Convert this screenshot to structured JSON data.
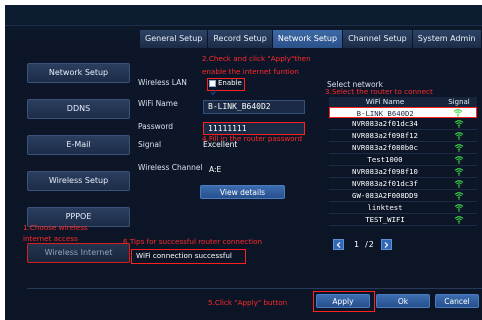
{
  "tabs": [
    "General Setup",
    "Record Setup",
    "Network Setup",
    "Channel Setup",
    "System Admin"
  ],
  "sidebar": [
    "Network Setup",
    "DDNS",
    "E-Mail",
    "Wireless Setup",
    "PPPOE",
    "Wireless Internet"
  ],
  "form": {
    "wireless_lan_label": "Wireless LAN",
    "enable_label": "Enable",
    "enable_checked": true,
    "wifi_name_label": "WiFi Name",
    "wifi_name_value": "B-LINK_B640D2",
    "password_label": "Password",
    "password_value": "11111111",
    "signal_label": "Signal",
    "signal_value": "Excellent",
    "channel_label": "Wireless Channel",
    "channel_value": "A:E",
    "details_button": "View details",
    "status_text": "WiFi connection successful"
  },
  "network_list": {
    "title": "Select network",
    "col_name": "WiFi Name",
    "col_signal": "Signal",
    "rows": [
      "B-LINK_B640D2",
      "NVR083a2f01dc34",
      "NVR083a2f098f12",
      "NVR083a2f080b0c",
      "Test1000",
      "NVR083a2f098f10",
      "NVR083a2f01dc3f",
      "GW-083A2F008DD9",
      "linktest",
      "TEST_WIFI"
    ],
    "selected_index": 0,
    "page_current": "1",
    "page_separator": "/",
    "page_total": "2"
  },
  "annotations": {
    "a1": "1.Choose wireless",
    "a1b": "internet access",
    "a2": "2.Check and click \"Apply\"then",
    "a2b": "enable the internet funtion",
    "a3": "3.Select the router to connect",
    "a4": "4.Fill in the router password",
    "a5": "5.Click \"Apply\" button",
    "a6": "6.Tips for successful router connection"
  },
  "footer": {
    "apply": "Apply",
    "ok": "Ok",
    "cancel": "Cancel"
  },
  "colors": {
    "accent": "#3068b8",
    "annotation": "#ff2a2a",
    "signal": "#3cd24a"
  }
}
